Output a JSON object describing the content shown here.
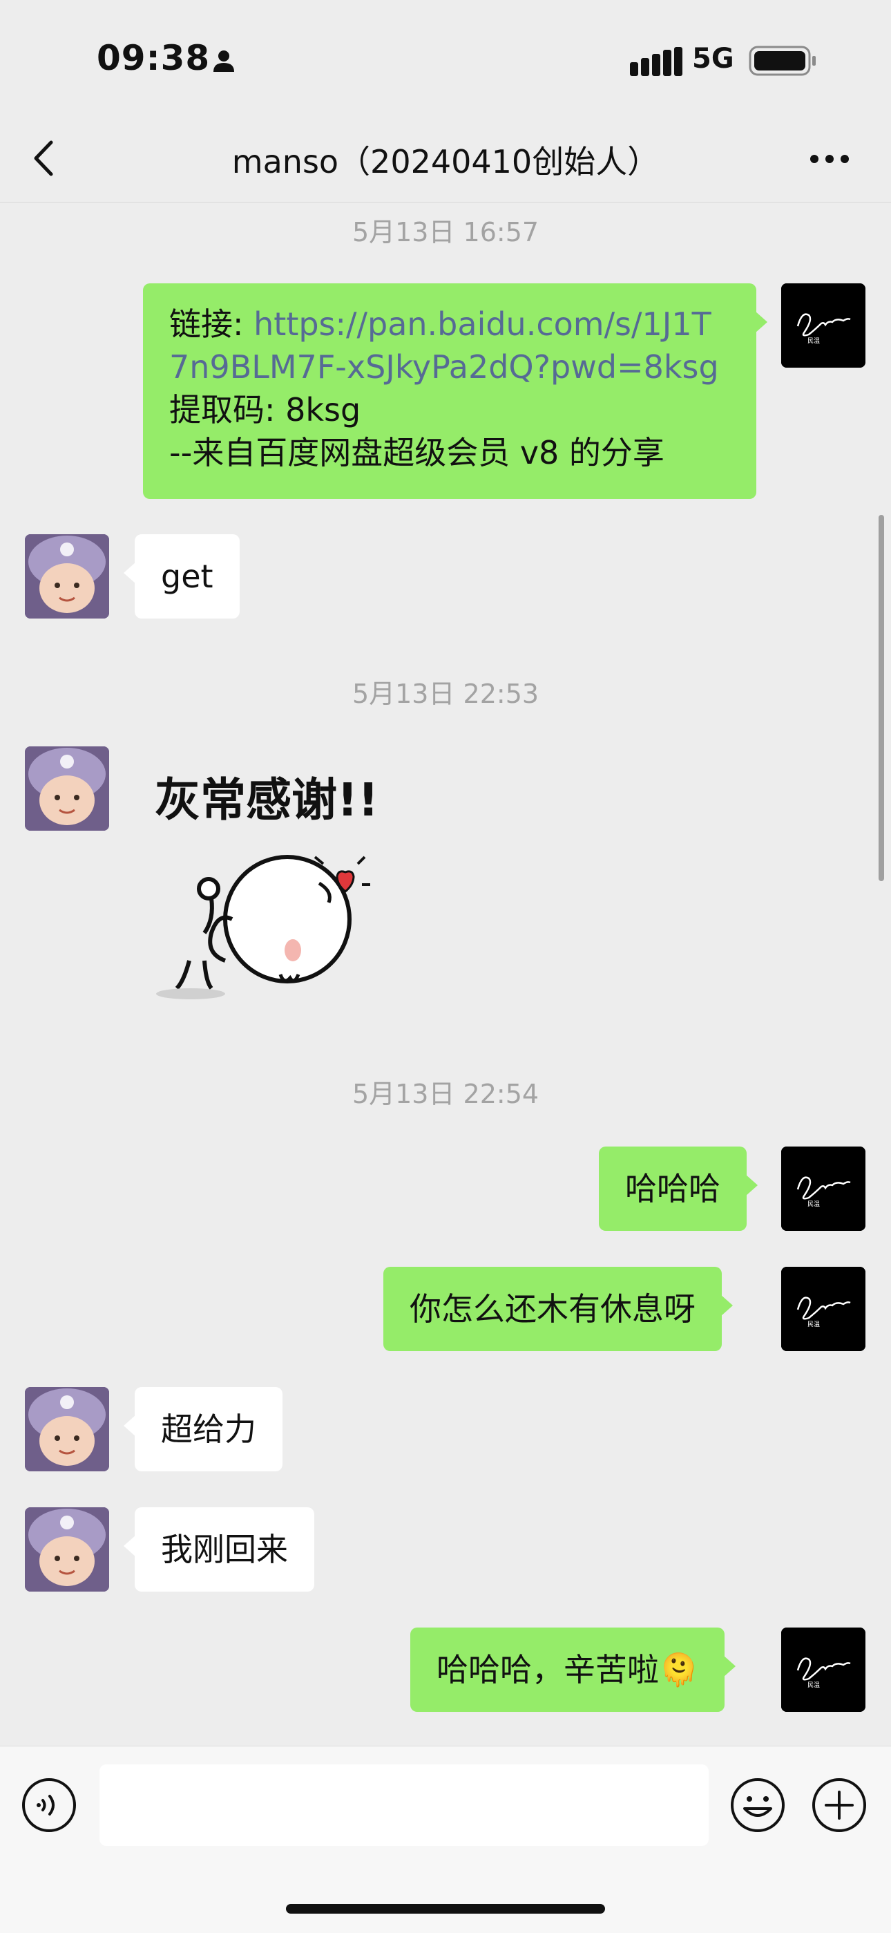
{
  "status_bar": {
    "time": "09:38",
    "network": "5G",
    "icons": [
      "person-icon",
      "signal-icon",
      "battery-icon"
    ]
  },
  "nav": {
    "title": "manso（20240410创始人）",
    "icons": [
      "back-icon",
      "more-icon"
    ]
  },
  "timestamps": {
    "t1": "5月13日 16:57",
    "t2": "5月13日 22:53",
    "t3": "5月13日 22:54"
  },
  "messages": {
    "m1": {
      "sender": "self",
      "line1_prefix": "链接: ",
      "link": "https://pan.baidu.com/s/1J1T7n9BLM7F-xSJkyPa2dQ?pwd=8ksg",
      "line3": "提取码: 8ksg",
      "line4": "--来自百度网盘超级会员 v8 的分享"
    },
    "m2": {
      "sender": "other",
      "text": "get"
    },
    "m3": {
      "sender": "other",
      "sticker_caption": "灰常感谢!!"
    },
    "m4": {
      "sender": "self",
      "text": "哈哈哈"
    },
    "m5": {
      "sender": "self",
      "text": "你怎么还木有休息呀"
    },
    "m6": {
      "sender": "other",
      "text": "超给力"
    },
    "m7": {
      "sender": "other",
      "text": "我刚回来"
    },
    "m8": {
      "sender": "self",
      "text": "哈哈哈，辛苦啦🫠"
    }
  },
  "input_bar": {
    "placeholder": "",
    "icons": [
      "voice-icon",
      "emoji-icon",
      "plus-icon"
    ]
  },
  "colors": {
    "self_bubble": "#95ec69",
    "other_bubble": "#ffffff",
    "background": "#ededed",
    "link": "#566a95"
  }
}
